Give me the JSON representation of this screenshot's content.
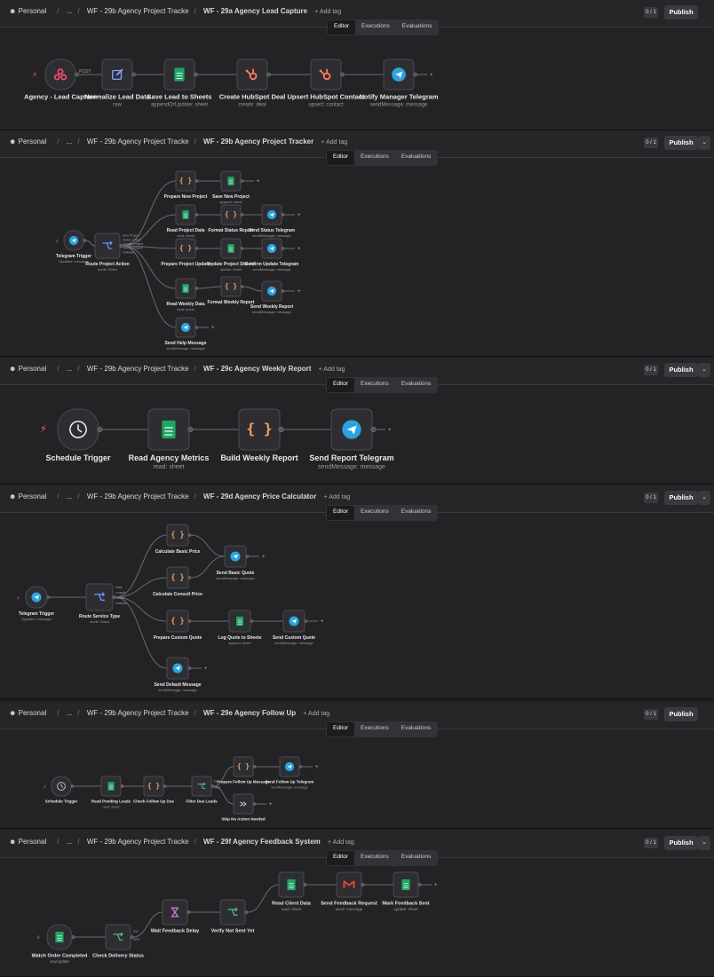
{
  "breadcrumb": {
    "personal": "Personal",
    "ellipsis": "...",
    "parent": "WF - 29b Agency Project Tracke",
    "add_tag": "+ Add tag"
  },
  "topbar": {
    "badge": "0 / 1",
    "publish": "Publish",
    "dropdown": "⌄"
  },
  "tabs": [
    "Editor",
    "Executions",
    "Evaluations"
  ],
  "colors": {
    "bg": "#232326",
    "node": "#2e2e32",
    "sheets": "#1fa463",
    "telegram": "#2aa3df",
    "hubspot": "#ff7a59",
    "webhook": "#ff4b6e",
    "code": "#f0a35a",
    "switch": "#4ec28a",
    "gmail": "#ea4335",
    "wait": "#d17ddc"
  },
  "panels": [
    {
      "title": "WF - 29a Agency Lead Capture",
      "nodes": [
        {
          "label": "Agency - Lead Capture",
          "sub": "",
          "icon": "webhook-icon"
        },
        {
          "label": "Normalize Lead Data",
          "sub": "raw",
          "icon": "edit-icon"
        },
        {
          "label": "Save Lead to Sheets",
          "sub": "appendOrUpdate: sheet",
          "icon": "sheets-icon"
        },
        {
          "label": "Create HubSpot Deal",
          "sub": "create: deal",
          "icon": "hubspot-icon"
        },
        {
          "label": "Upsert HubSpot Contact",
          "sub": "upsert: contact",
          "icon": "hubspot-icon"
        },
        {
          "label": "Notify Manager Telegram",
          "sub": "sendMessage: message",
          "icon": "telegram-icon"
        }
      ],
      "edge_label": "POST"
    },
    {
      "title": "WF - 29b Agency Project Tracker",
      "nodes": [
        {
          "label": "Telegram Trigger",
          "sub": "Updates: message",
          "icon": "telegram-icon"
        },
        {
          "label": "Route Project Action",
          "sub": "mode: Rules",
          "icon": "switch-icon"
        },
        {
          "label": "Prepare New Project",
          "sub": "",
          "icon": "code-icon"
        },
        {
          "label": "Save New Project",
          "sub": "append: sheet",
          "icon": "sheets-icon"
        },
        {
          "label": "Read Project Data",
          "sub": "read: sheet",
          "icon": "sheets-icon"
        },
        {
          "label": "Format Status Report",
          "sub": "",
          "icon": "code-icon"
        },
        {
          "label": "Send Status Telegram",
          "sub": "sendMessage: message",
          "icon": "telegram-icon"
        },
        {
          "label": "Prepare Project Update",
          "sub": "",
          "icon": "code-icon"
        },
        {
          "label": "Update Project Sheets",
          "sub": "update: sheet",
          "icon": "sheets-icon"
        },
        {
          "label": "Confirm Update Telegram",
          "sub": "sendMessage: message",
          "icon": "telegram-icon"
        },
        {
          "label": "Read Weekly Data",
          "sub": "read: sheet",
          "icon": "sheets-icon"
        },
        {
          "label": "Format Weekly Report",
          "sub": "",
          "icon": "code-icon"
        },
        {
          "label": "Send Weekly Report",
          "sub": "sendMessage: message",
          "icon": "telegram-icon"
        },
        {
          "label": "Send Help Message",
          "sub": "sendMessage: message",
          "icon": "telegram-icon"
        }
      ],
      "outputs": [
        "New Project",
        "Status Check",
        "Update Project",
        "Weekly Report",
        "Fallback"
      ]
    },
    {
      "title": "WF - 29c Agency Weekly Report",
      "nodes": [
        {
          "label": "Schedule Trigger",
          "sub": "",
          "icon": "clock-icon"
        },
        {
          "label": "Read Agency Metrics",
          "sub": "read: sheet",
          "icon": "sheets-icon"
        },
        {
          "label": "Build Weekly Report",
          "sub": "",
          "icon": "code-icon"
        },
        {
          "label": "Send Report Telegram",
          "sub": "sendMessage: message",
          "icon": "telegram-icon"
        }
      ]
    },
    {
      "title": "WF - 29d Agency Price Calculator",
      "nodes": [
        {
          "label": "Telegram Trigger",
          "sub": "Updates: message",
          "icon": "telegram-icon"
        },
        {
          "label": "Route Service Type",
          "sub": "mode: Rules",
          "icon": "switch-icon"
        },
        {
          "label": "Calculate Basic Price",
          "sub": "",
          "icon": "code-icon"
        },
        {
          "label": "Send Basic Quote",
          "sub": "sendMessage: message",
          "icon": "telegram-icon"
        },
        {
          "label": "Calculate Consult Price",
          "sub": "",
          "icon": "code-icon"
        },
        {
          "label": "Prepare Custom Quote",
          "sub": "",
          "icon": "code-icon"
        },
        {
          "label": "Log Quote to Sheets",
          "sub": "append: sheet",
          "icon": "sheets-icon"
        },
        {
          "label": "Send Custom Quote",
          "sub": "sendMessage: message",
          "icon": "telegram-icon"
        },
        {
          "label": "Send Default Message",
          "sub": "sendMessage: message",
          "icon": "telegram-icon"
        }
      ],
      "outputs": [
        "basic",
        "consult",
        "custom",
        "Fallback"
      ]
    },
    {
      "title": "WF - 29e Agency Follow Up",
      "nodes": [
        {
          "label": "Schedule Trigger",
          "sub": "",
          "icon": "clock-icon"
        },
        {
          "label": "Read Pending Leads",
          "sub": "read: sheet",
          "icon": "sheets-icon"
        },
        {
          "label": "Check Follow Up Due",
          "sub": "",
          "icon": "code-icon"
        },
        {
          "label": "Filter Due Leads",
          "sub": "",
          "icon": "if-icon"
        },
        {
          "label": "Prepare Follow Up Message",
          "sub": "",
          "icon": "code-icon"
        },
        {
          "label": "Send Follow Up Telegram",
          "sub": "sendMessage: message",
          "icon": "telegram-icon"
        },
        {
          "label": "Skip No Action Needed",
          "sub": "",
          "icon": "noop-icon"
        }
      ],
      "outputs": [
        "true",
        "false"
      ]
    },
    {
      "title": "WF - 29f Agency Feedback System",
      "nodes": [
        {
          "label": "Watch Order Completed",
          "sub": "anyUpdate",
          "icon": "sheets-icon"
        },
        {
          "label": "Check Delivery Status",
          "sub": "",
          "icon": "if-icon"
        },
        {
          "label": "Wait Feedback Delay",
          "sub": "",
          "icon": "wait-icon"
        },
        {
          "label": "Verify Not Sent Yet",
          "sub": "",
          "icon": "if-icon"
        },
        {
          "label": "Read Client Data",
          "sub": "read: sheet",
          "icon": "sheets-icon"
        },
        {
          "label": "Send Feedback Request",
          "sub": "send: message",
          "icon": "gmail-icon"
        },
        {
          "label": "Mark Feedback Sent",
          "sub": "update: sheet",
          "icon": "sheets-icon"
        }
      ],
      "outputs": [
        "true",
        "false"
      ]
    }
  ]
}
